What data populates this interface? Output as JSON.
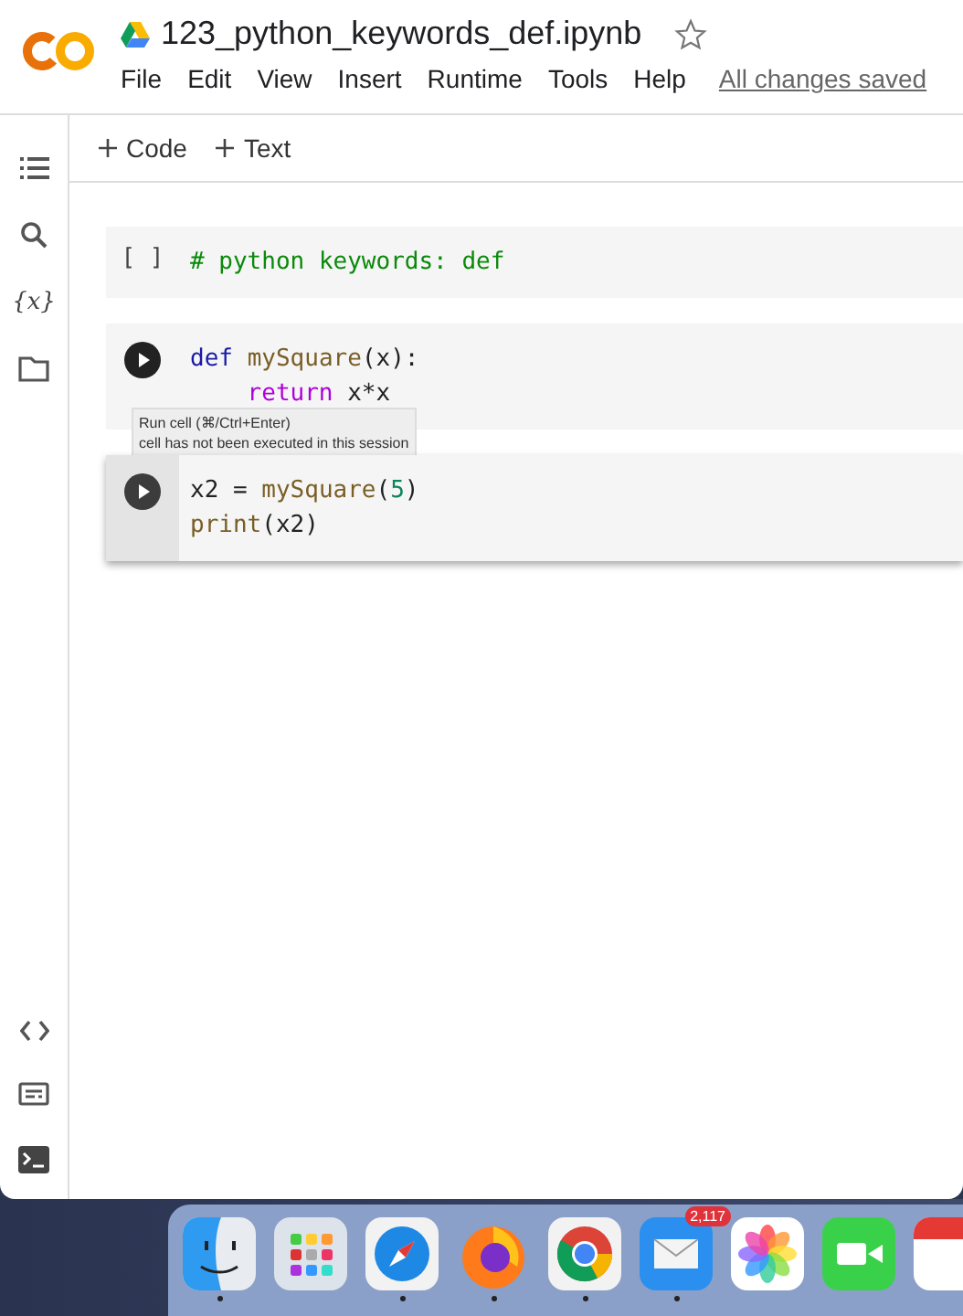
{
  "header": {
    "title": "123_python_keywords_def.ipynb",
    "starred": false,
    "menu": [
      "File",
      "Edit",
      "View",
      "Insert",
      "Runtime",
      "Tools",
      "Help"
    ],
    "save_status": "All changes saved"
  },
  "toolbar": [
    {
      "label": "Code"
    },
    {
      "label": "Text"
    }
  ],
  "sidebar": {
    "top": [
      {
        "kind": "toc"
      },
      {
        "kind": "search"
      },
      {
        "kind": "variables",
        "label": "{x}"
      },
      {
        "kind": "folder"
      }
    ],
    "bottom": [
      {
        "kind": "code"
      },
      {
        "kind": "palette"
      },
      {
        "kind": "terminal"
      }
    ]
  },
  "cells": [
    {
      "kind": "idle",
      "prompt": "[ ]",
      "focused": false,
      "lines": [
        {
          "indented": false,
          "tokens": [
            {
              "kind": "comment",
              "text": "# python keywords: def"
            }
          ]
        }
      ]
    },
    {
      "kind": "run",
      "focused": false,
      "hovered": true,
      "lines": [
        {
          "indented": false,
          "tokens": [
            {
              "kind": "keyword",
              "text": "def"
            },
            {
              "kind": "func",
              "text": "mySquare"
            },
            {
              "kind": "plain",
              "text": "(x):"
            }
          ]
        },
        {
          "indented": true,
          "tokens": [
            {
              "kind": "control",
              "text": "return"
            },
            {
              "kind": "plain",
              "text": "x*x"
            }
          ]
        }
      ],
      "tooltip": [
        "Run cell (⌘/Ctrl+Enter)",
        "cell has not been executed in this session"
      ]
    },
    {
      "kind": "run",
      "focused": true,
      "hovered": false,
      "lines": [
        {
          "indented": false,
          "tokens": [
            {
              "kind": "plain",
              "text": "x2 ="
            },
            {
              "kind": "func",
              "text": "mySquare"
            },
            {
              "kind": "plain",
              "text": "("
            },
            {
              "kind": "number",
              "text": "5"
            },
            {
              "kind": "plain",
              "text": ")"
            }
          ]
        },
        {
          "indented": false,
          "tokens": [
            {
              "kind": "func",
              "text": "print"
            },
            {
              "kind": "plain",
              "text": "(x2)"
            }
          ]
        }
      ]
    }
  ],
  "dock": [
    {
      "kind": "finder",
      "running": true
    },
    {
      "kind": "launchpad",
      "running": false
    },
    {
      "kind": "safari",
      "running": true
    },
    {
      "kind": "firefox",
      "running": true
    },
    {
      "kind": "chrome",
      "running": true
    },
    {
      "kind": "mail",
      "running": true,
      "badge": "2,117"
    },
    {
      "kind": "photos",
      "running": false
    },
    {
      "kind": "facetime",
      "running": false
    },
    {
      "kind": "calendar",
      "running": false
    }
  ]
}
